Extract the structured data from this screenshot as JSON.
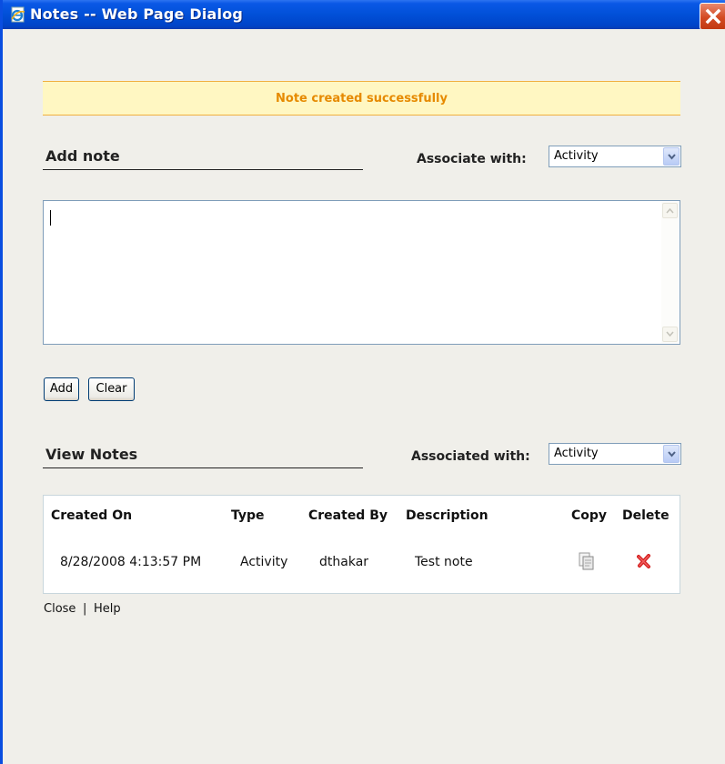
{
  "window": {
    "title": "Notes -- Web Page Dialog"
  },
  "banner": {
    "message": "Note created successfully"
  },
  "add_note": {
    "title": "Add note",
    "associate_label": "Associate with:",
    "associate_value": "Activity",
    "note_text": "",
    "add_label": "Add",
    "clear_label": "Clear"
  },
  "view_notes": {
    "title": "View Notes",
    "associated_label": "Associated with:",
    "associated_value": "Activity",
    "columns": {
      "created_on": "Created On",
      "type": "Type",
      "created_by": "Created By",
      "description": "Description",
      "copy": "Copy",
      "delete": "Delete"
    },
    "rows": [
      {
        "created_on": "8/28/2008 4:13:57 PM",
        "type": "Activity",
        "created_by": "dthakar",
        "description": "Test note"
      }
    ]
  },
  "footer": {
    "close_label": "Close",
    "separator": "|",
    "help_label": "Help"
  },
  "icons": {
    "window": "ie-page-icon",
    "close": "close-icon",
    "copy": "copy-icon",
    "delete": "delete-icon"
  },
  "colors": {
    "titlebar": "#0150d8",
    "banner_bg": "#fff7c2",
    "banner_text": "#e68a00",
    "delete_icon": "#d42020"
  }
}
